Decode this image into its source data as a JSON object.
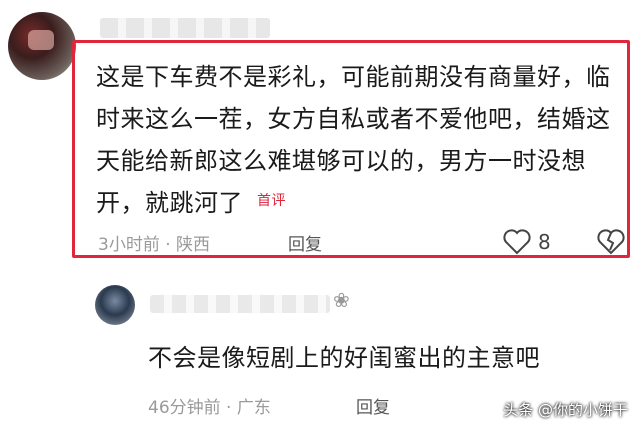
{
  "comment1": {
    "body": "这是下车费不是彩礼，可能前期没有商量好，临时来这么一茬，女方自私或者不爱他吧，结婚这天能给新郎这么难堪够可以的，男方一时没想开，就跳河了",
    "badge": "首评",
    "meta": "3小时前 · 陕西",
    "reply_label": "回复",
    "like_count": "8"
  },
  "comment2": {
    "body": "不会是像短剧上的好闺蜜出的主意吧",
    "meta": "46分钟前 · 广东",
    "reply_label": "回复"
  },
  "watermark": "头条 @你的小饼干",
  "colors": {
    "highlight": "#e0263c",
    "meta": "#9a9a9a"
  },
  "icons": [
    "heart-icon",
    "broken-heart-icon",
    "flower-icon"
  ]
}
